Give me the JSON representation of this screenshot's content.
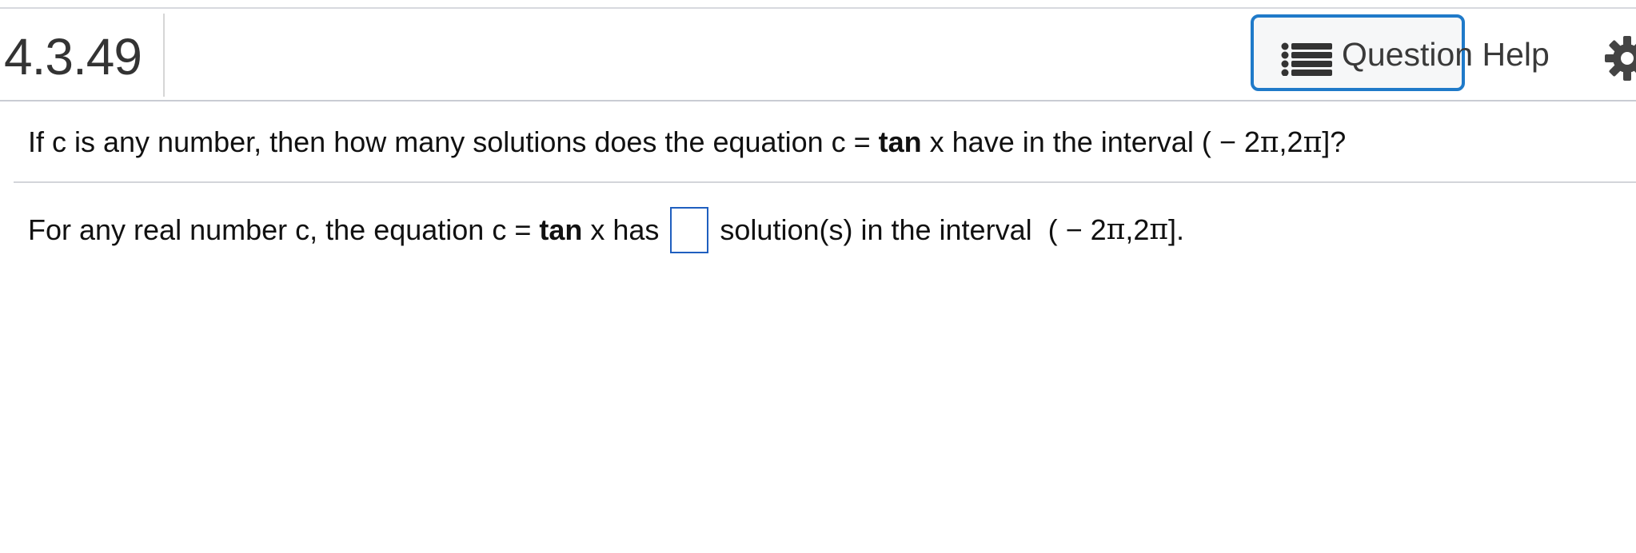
{
  "header": {
    "question_number": "4.3.49",
    "help_button_label": "Question Help"
  },
  "icons": {
    "help": "list-icon",
    "settings": "gear-icon"
  },
  "question": {
    "text_before_tan": "If c is any number, then how many solutions does the equation c = ",
    "tan": "tan",
    "text_after_tan": " x have in the interval ( − 2",
    "pi1": "π",
    "comma2": ",2",
    "pi2": "π",
    "end": "]?"
  },
  "answer": {
    "text_before_tan": "For any real number c, the equation c = ",
    "tan": "tan",
    "text_after_tan": " x has",
    "input_value": "",
    "text_after_box": "solution(s) in the interval  ( − 2",
    "pi1": "π",
    "comma2": ",2",
    "pi2": "π",
    "end": "]."
  },
  "colors": {
    "accent": "#1f7ac9",
    "input_border": "#1f5fbf",
    "divider": "#d3d5da"
  }
}
